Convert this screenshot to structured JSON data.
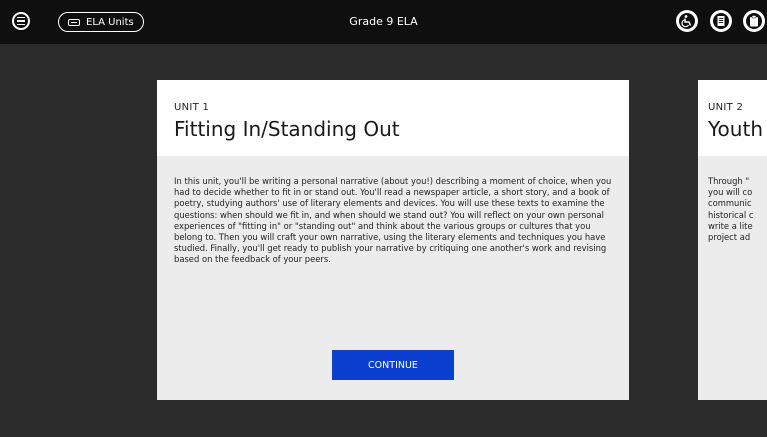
{
  "topbar": {
    "title": "Grade 9 ELA",
    "units_button_label": "ELA Units",
    "icons": [
      "menu-icon",
      "keyboard-icon",
      "accessibility-icon",
      "notes-icon",
      "clipboard-icon"
    ]
  },
  "cards": [
    {
      "unit_label": "UNIT 1",
      "title": "Fitting In/Standing Out",
      "description": "In this unit, you'll be writing a personal narrative (about you!) describing a moment of choice, when you had to decide whether to fit in or stand out. You'll read a newspaper article, a short story, and a book of poetry, studying authors' use of literary elements and devices. You will use these texts to examine the questions: when should we fit in, and when should we stand out? You will reflect on your own personal experiences of \"fitting in\" or \"standing out\" and think about the various groups or cultures that you belong to. Then you will craft your own narrative, using the literary elements and techniques you have studied. Finally, you'll get ready to publish your narrative by critiquing one another's work and revising based on the feedback of your peers.",
      "button_label": "CONTINUE"
    },
    {
      "unit_label": "UNIT 2",
      "title": "Youth",
      "description_lines": [
        "Through \"",
        "you will co",
        "communic",
        "historical c",
        "write a lite",
        "project ad"
      ]
    }
  ],
  "colors": {
    "topbar_bg": "#0f0f0f",
    "page_bg": "#2c2c2c",
    "card_bg": "#ececec",
    "button_bg": "#0a3fd0"
  }
}
